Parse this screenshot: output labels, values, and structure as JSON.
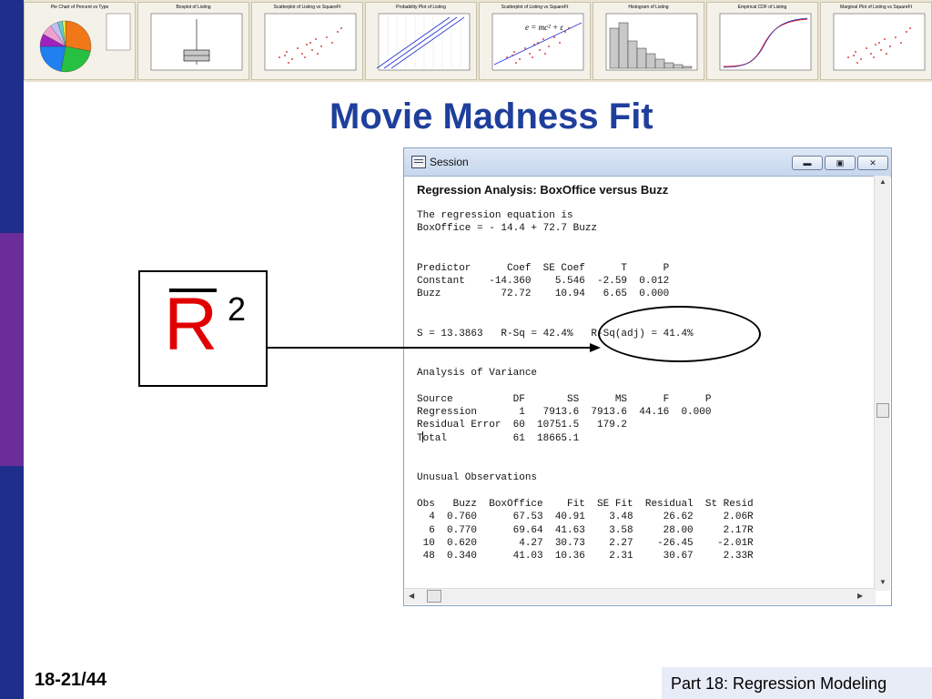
{
  "slide": {
    "title": "Movie Madness Fit",
    "slide_number": "18-21/44",
    "footer_text": "Part 18: Regression Modeling",
    "accent_color": "#1f3f9c",
    "sidebar_colors": [
      "#1f2e8a",
      "#6a2d9a",
      "#1f2e8a"
    ]
  },
  "thumbnails": [
    {
      "title": "Pie Chart of Percent vs Type",
      "kind": "pie"
    },
    {
      "title": "Boxplot of Listing",
      "kind": "boxplot"
    },
    {
      "title": "Scatterplot of Listing vs SquareFt",
      "kind": "scatter"
    },
    {
      "title": "Probability Plot of Listing",
      "kind": "probability"
    },
    {
      "title": "Scatterplot of Listing vs SquareFt",
      "kind": "scatter-fit"
    },
    {
      "title": "Histogram of Listing",
      "kind": "histogram"
    },
    {
      "title": "Empirical CDF of Listing",
      "kind": "cdf"
    },
    {
      "title": "Marginal Plot of Listing vs SquareFt",
      "kind": "marginal"
    }
  ],
  "rbar_symbol": {
    "letter": "R",
    "superscript": "2",
    "bar_color": "#000000",
    "letter_color": "#e00000"
  },
  "session_window": {
    "title": "Session",
    "heading": "Regression Analysis: BoxOffice versus Buzz",
    "lines": [
      "The regression equation is",
      "BoxOffice = - 14.4 + 72.7 Buzz",
      "",
      "",
      "Predictor      Coef  SE Coef      T      P",
      "Constant    -14.360    5.546  -2.59  0.012",
      "Buzz          72.72    10.94   6.65  0.000",
      "",
      "",
      "S = 13.3863   R-Sq = 42.4%   R-Sq(adj) = 41.4%",
      "",
      "",
      "Analysis of Variance",
      "",
      "Source          DF       SS      MS      F      P",
      "Regression       1   7913.6  7913.6  44.16  0.000",
      "Residual Error  60  10751.5   179.2",
      "Total           61  18665.1",
      "",
      "",
      "Unusual Observations",
      "",
      "Obs   Buzz  BoxOffice    Fit  SE Fit  Residual  St Resid",
      "  4  0.760      67.53  40.91    3.48     26.62     2.06R",
      "  6  0.770      69.64  41.63    3.58     28.00     2.17R",
      " 10  0.620       4.27  30.73    2.27    -26.45    -2.01R",
      " 48  0.340      41.03  10.36    2.31     30.67     2.33R"
    ]
  }
}
